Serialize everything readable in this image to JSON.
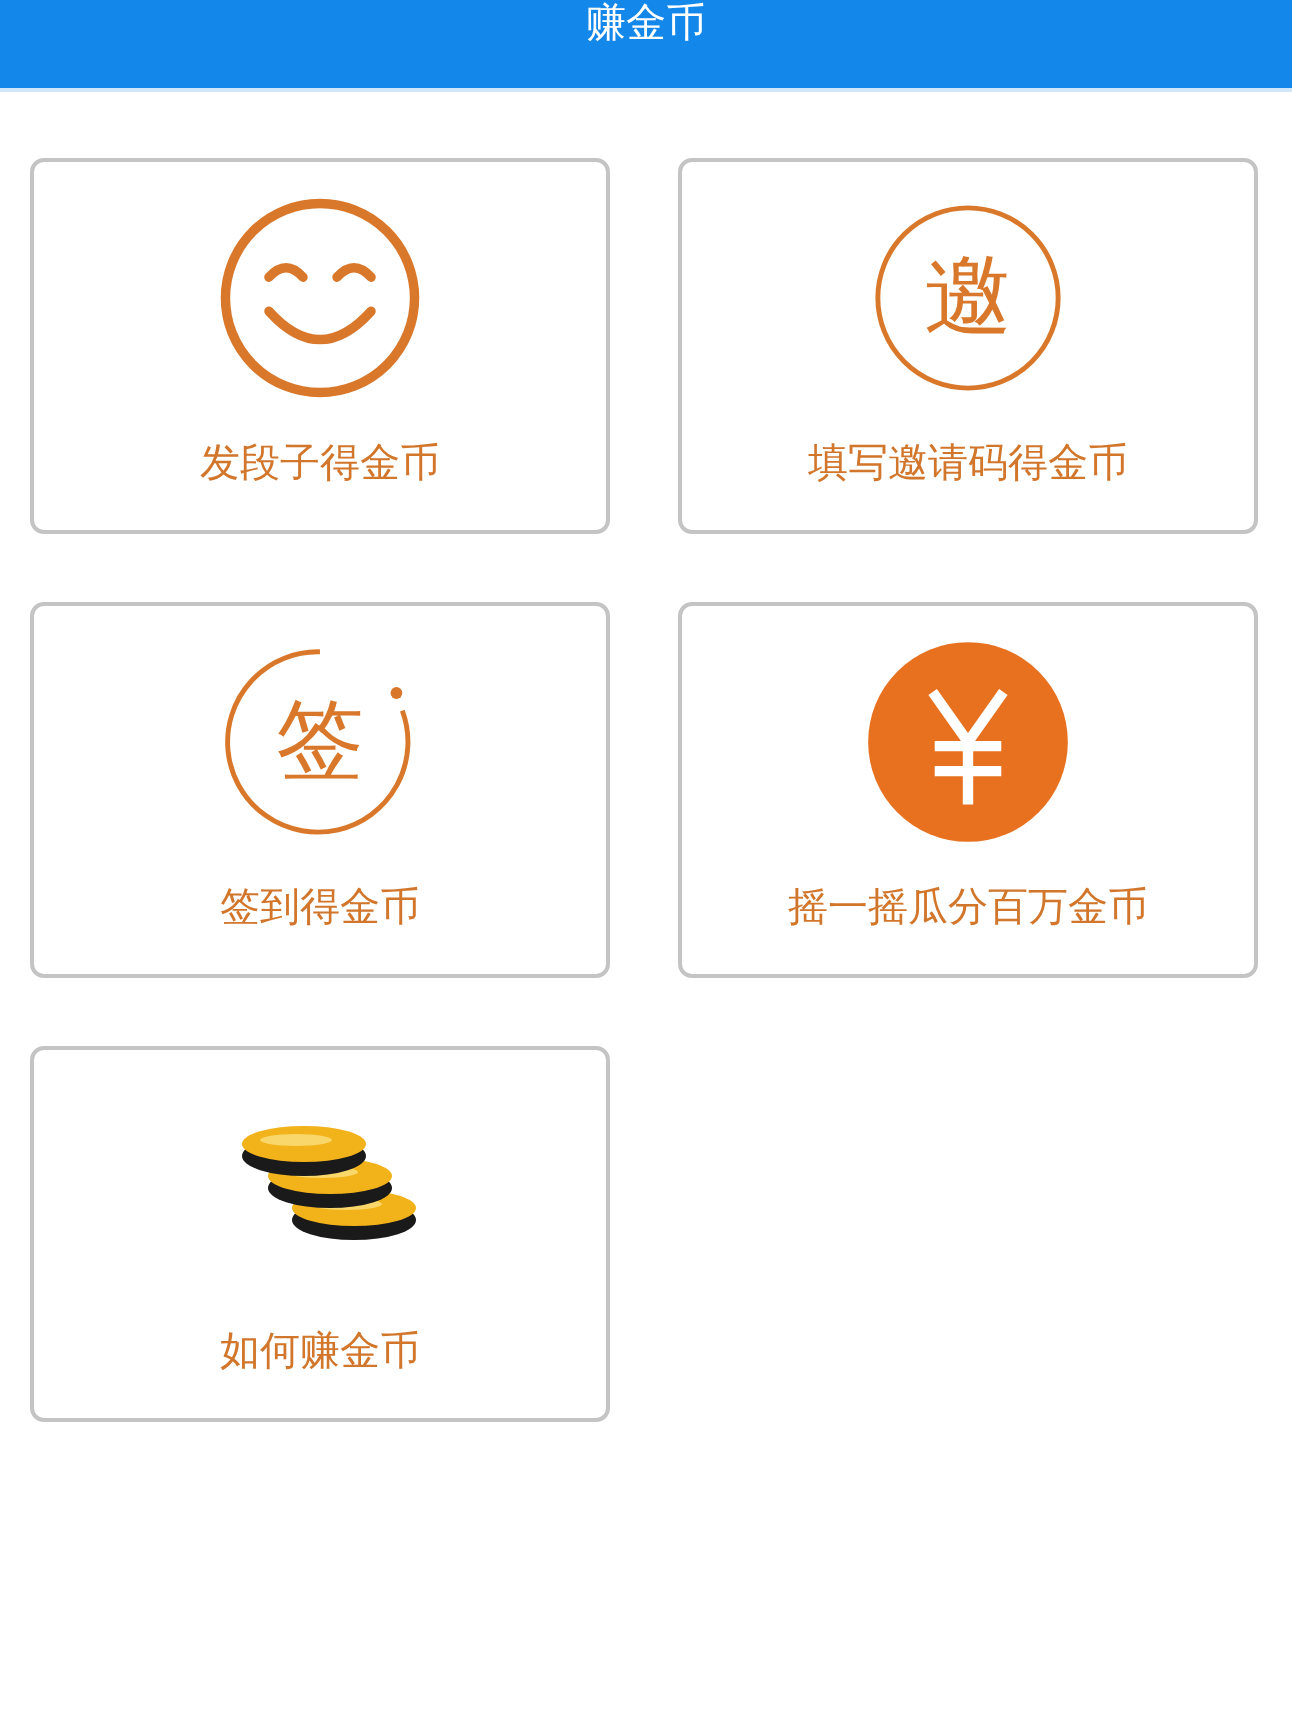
{
  "header": {
    "title": "赚金币"
  },
  "cards": [
    {
      "kind": "smile",
      "label": "发段子得金币"
    },
    {
      "kind": "char-circle",
      "glyph": "邀",
      "label": "填写邀请码得金币"
    },
    {
      "kind": "char-circle-dot",
      "glyph": "签",
      "label": "签到得金币"
    },
    {
      "kind": "yen",
      "label": "摇一摇瓜分百万金币"
    },
    {
      "kind": "coins",
      "label": "如何赚金币"
    }
  ]
}
